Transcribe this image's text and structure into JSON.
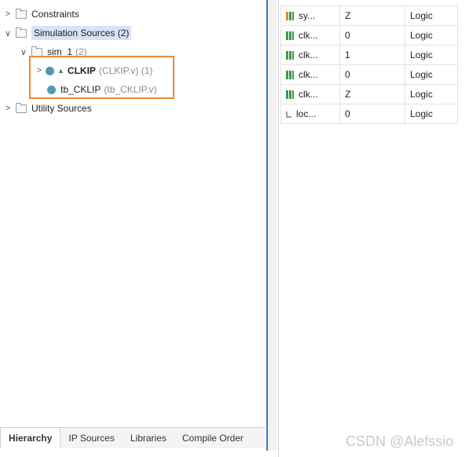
{
  "hierarchy": {
    "cut_row_text": "",
    "items": [
      {
        "label": "Constraints",
        "expand": ">"
      },
      {
        "label": "Simulation Sources (2)",
        "expand": "∨"
      },
      {
        "label": "sim_1",
        "count": "(2)",
        "expand": "∨"
      },
      {
        "label": "CLKIP",
        "file": "(CLKIP.v) (1)",
        "expand": ">"
      },
      {
        "label": "tb_CKLIP",
        "file": "(tb_CKLIP.v)"
      },
      {
        "label": "Utility Sources",
        "expand": ">"
      }
    ]
  },
  "tabs": [
    "Hierarchy",
    "IP Sources",
    "Libraries",
    "Compile Order"
  ],
  "signals": [
    {
      "name": "sy...",
      "value": "Z",
      "type": "Logic",
      "icon": "bus-orange"
    },
    {
      "name": "clk...",
      "value": "0",
      "type": "Logic",
      "icon": "bus"
    },
    {
      "name": "clk...",
      "value": "1",
      "type": "Logic",
      "icon": "bus"
    },
    {
      "name": "clk...",
      "value": "0",
      "type": "Logic",
      "icon": "bus"
    },
    {
      "name": "clk...",
      "value": "Z",
      "type": "Logic",
      "icon": "bus"
    },
    {
      "name": "loc...",
      "value": "0",
      "type": "Logic",
      "icon": "local"
    }
  ],
  "watermark": "CSDN @Alefssio",
  "colors": {
    "selection": "#d7e3f7",
    "highlight_box": "#e8893a",
    "divider": "#3f74c9",
    "sim_dot": "#4d9ab4"
  }
}
